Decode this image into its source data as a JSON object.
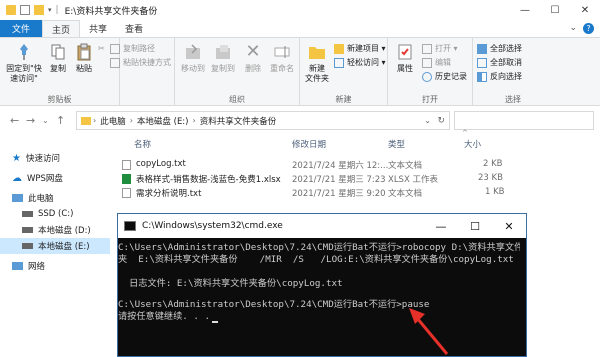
{
  "window": {
    "path_title": "E:\\资料共享文件夹备份",
    "controls": [
      "—",
      "☐",
      "✕"
    ]
  },
  "ribbon_tabs": {
    "file": "文件",
    "home": "主页",
    "share": "共享",
    "view": "查看"
  },
  "clipboard": {
    "pin": "固定到\"快\n速访问\"",
    "copy": "复制",
    "paste": "粘贴",
    "copy_path": "复制路径",
    "paste_shortcut": "粘贴快捷方式",
    "cut": "剪切",
    "group": "剪贴板"
  },
  "organize": {
    "move_to": "移动到",
    "copy_to": "复制到",
    "delete": "删除",
    "rename": "重命名",
    "group": "组织"
  },
  "new": {
    "new_folder": "新建\n文件夹",
    "new_item": "新建项目 ▾",
    "easy_access": "轻松访问 ▾",
    "group": "新建"
  },
  "open": {
    "properties": "属性",
    "open": "打开 ▾",
    "edit": "编辑",
    "history": "历史记录",
    "group": "打开"
  },
  "select": {
    "select_all": "全部选择",
    "select_none": "全部取消",
    "invert": "反向选择",
    "group": "选择"
  },
  "address": {
    "segments": [
      "此电脑",
      "本地磁盘 (E:)",
      "资料共享文件夹备份"
    ]
  },
  "nav": {
    "quick_access": "快速访问",
    "wps": "WPS网盘",
    "this_pc": "此电脑",
    "ssd": "SSD (C:)",
    "local_d": "本地磁盘 (D:)",
    "local_e": "本地磁盘 (E:)",
    "network": "网络"
  },
  "columns": {
    "name": "名称",
    "date": "修改日期",
    "type": "类型",
    "size": "大小"
  },
  "files": [
    {
      "name": "copyLog.txt",
      "date": "2021/7/24 星期六 12:...",
      "type": "文本文档",
      "size": "2 KB"
    },
    {
      "name": "表格样式-销售数据-浅蓝色-免费1.xlsx",
      "date": "2021/7/21 星期三 7:23",
      "type": "XLSX 工作表",
      "size": "23 KB"
    },
    {
      "name": "需求分析说明.txt",
      "date": "2021/7/21 星期三 9:20",
      "type": "文本文档",
      "size": "1 KB"
    }
  ],
  "cmd": {
    "title": "C:\\Windows\\system32\\cmd.exe",
    "lines": [
      "C:\\Users\\Administrator\\Desktop\\7.24\\CMD运行Bat不运行>robocopy D:\\资料共享文件",
      "夹  E:\\资料共享文件夹备份    /MIR  /S   /LOG:E:\\资料共享文件夹备份\\copyLog.txt",
      "",
      "  日志文件: E:\\资料共享文件夹备份\\copyLog.txt",
      "",
      "C:\\Users\\Administrator\\Desktop\\7.24\\CMD运行Bat不运行>pause",
      "请按任意键继续. . ."
    ]
  },
  "colors": {
    "accent": "#1979ca",
    "arrow": "#e8302a",
    "cmd_bg": "#0c0c0c",
    "folder": "#f4c542"
  }
}
